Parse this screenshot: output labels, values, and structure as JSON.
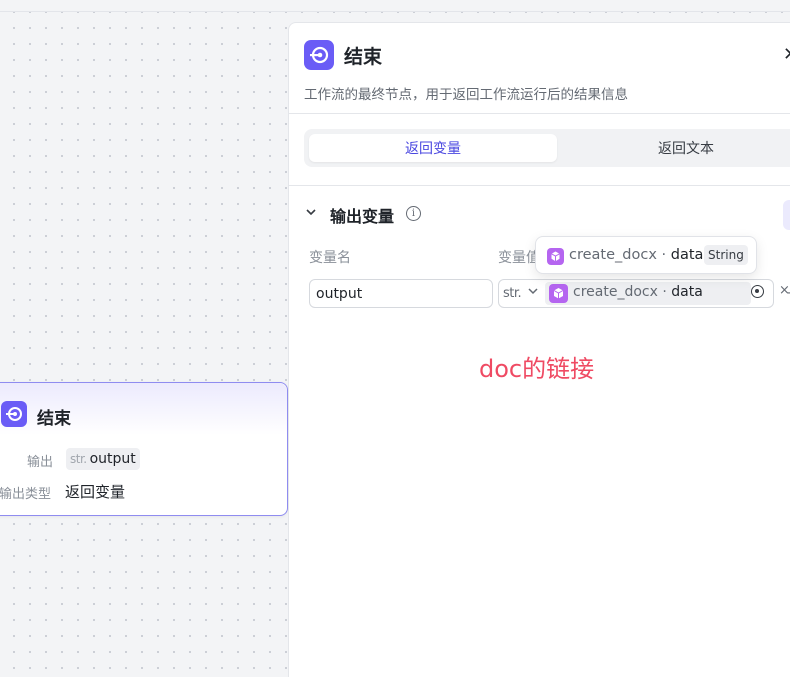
{
  "node": {
    "title": "结束",
    "output_label": "输出",
    "output_type": "str.",
    "output_name": "output",
    "output_type_label": "输出类型",
    "output_type_value": "返回变量"
  },
  "panel": {
    "title": "结束",
    "description": "工作流的最终节点，用于返回工作流运行后的结果信息",
    "tabs": [
      {
        "label": "返回变量",
        "active": true
      },
      {
        "label": "返回文本",
        "active": false
      }
    ],
    "section_title": "输出变量",
    "columns": {
      "name": "变量名",
      "value": "变量值"
    },
    "row": {
      "name": "output",
      "type": "str.",
      "ref_source": "create_docx",
      "ref_separator": "·",
      "ref_field": "data",
      "clear_symbol": "×",
      "more_symbol": "-"
    },
    "tooltip": {
      "source": "create_docx",
      "separator": "·",
      "field": "data",
      "type": "String"
    }
  },
  "annotation": "doc的链接",
  "colors": {
    "accent": "#6a5cf6",
    "plugin": "#b565f0",
    "annotation": "#ef4a63",
    "active_tab_text": "#4a47e0"
  }
}
